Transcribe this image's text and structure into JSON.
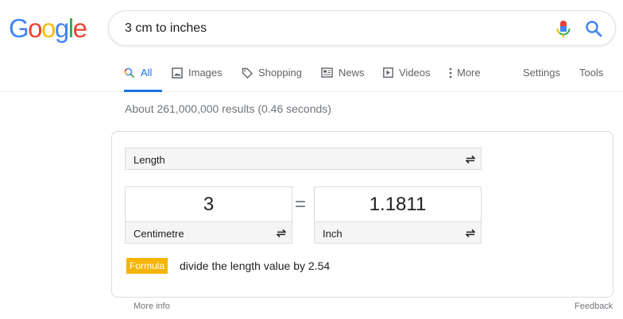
{
  "logo": {
    "letters": [
      "G",
      "o",
      "o",
      "g",
      "l",
      "e"
    ],
    "colors": [
      "#4285f4",
      "#ea4335",
      "#fbbc05",
      "#4285f4",
      "#34a853",
      "#ea4335"
    ]
  },
  "search": {
    "query": "3 cm to inches"
  },
  "tabs": [
    {
      "label": "All",
      "icon": "search-icon"
    },
    {
      "label": "Images",
      "icon": "image-icon"
    },
    {
      "label": "Shopping",
      "icon": "tag-icon"
    },
    {
      "label": "News",
      "icon": "newspaper-icon"
    },
    {
      "label": "Videos",
      "icon": "play-icon"
    },
    {
      "label": "More",
      "icon": "kebab-icon"
    }
  ],
  "tools": {
    "settings": "Settings",
    "tools": "Tools"
  },
  "stats": "About 261,000,000 results (0.46 seconds)",
  "converter": {
    "measure": "Length",
    "from": {
      "value": "3",
      "unit": "Centimetre"
    },
    "equals": "=",
    "to": {
      "value": "1.1811",
      "unit": "Inch"
    },
    "formula_label": "Formula",
    "formula_text": "divide the length value by 2.54"
  },
  "footer": {
    "more_info": "More info",
    "feedback": "Feedback"
  },
  "colors": {
    "accent": "#1a73e8",
    "formula_badge": "#f4b400"
  }
}
